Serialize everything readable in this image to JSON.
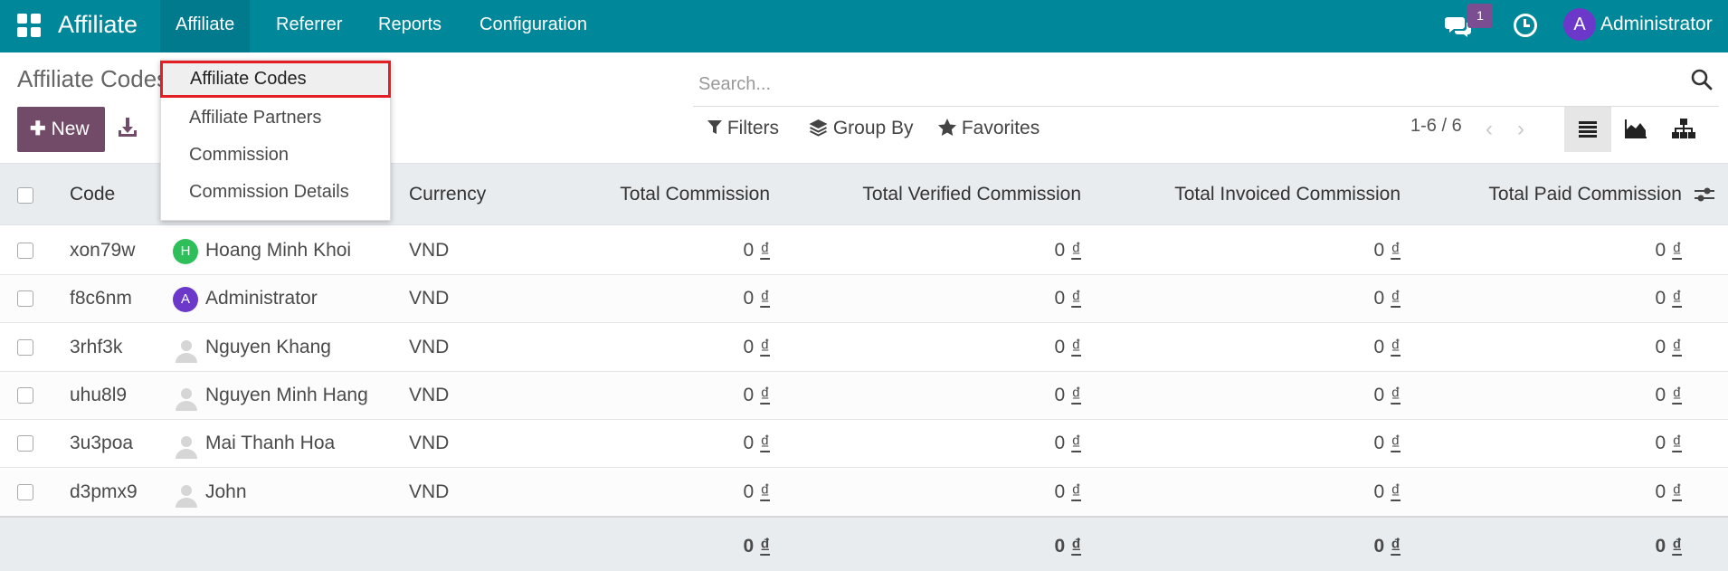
{
  "navbar": {
    "brand": "Affiliate",
    "menus": [
      "Affiliate",
      "Referrer",
      "Reports",
      "Configuration"
    ],
    "chat_count": "1",
    "user_initial": "A",
    "user_name": "Administrator",
    "bg_color": "#00879a"
  },
  "dropdown": {
    "items": [
      "Affiliate Codes",
      "Affiliate Partners",
      "Commission",
      "Commission Details"
    ],
    "selected": "Affiliate Codes"
  },
  "control_panel": {
    "breadcrumb": "Affiliate Codes",
    "new_label": "New",
    "search_placeholder": "Search...",
    "filters_label": "Filters",
    "group_by_label": "Group By",
    "favorites_label": "Favorites",
    "pager": "1-6 / 6",
    "accent_color": "#714b67"
  },
  "table": {
    "columns": {
      "code": "Code",
      "currency": "Currency",
      "total_commission": "Total Commission",
      "total_verified": "Total Verified Commission",
      "total_invoiced": "Total Invoiced Commission",
      "total_paid": "Total Paid Commission"
    },
    "rows": [
      {
        "code": "xon79w",
        "partner": "Hoang Minh Khoi",
        "avatar": "H",
        "avatar_color": "#2ebf5b",
        "currency": "VND",
        "total": "0",
        "verified": "0",
        "invoiced": "0",
        "paid": "0"
      },
      {
        "code": "f8c6nm",
        "partner": "Administrator",
        "avatar": "A",
        "avatar_color": "#6b38c9",
        "currency": "VND",
        "total": "0",
        "verified": "0",
        "invoiced": "0",
        "paid": "0"
      },
      {
        "code": "3rhf3k",
        "partner": "Nguyen Khang",
        "avatar": "",
        "avatar_color": "",
        "currency": "VND",
        "total": "0",
        "verified": "0",
        "invoiced": "0",
        "paid": "0"
      },
      {
        "code": "uhu8l9",
        "partner": "Nguyen Minh Hang",
        "avatar": "",
        "avatar_color": "",
        "currency": "VND",
        "total": "0",
        "verified": "0",
        "invoiced": "0",
        "paid": "0"
      },
      {
        "code": "3u3poa",
        "partner": "Mai Thanh Hoa",
        "avatar": "",
        "avatar_color": "",
        "currency": "VND",
        "total": "0",
        "verified": "0",
        "invoiced": "0",
        "paid": "0"
      },
      {
        "code": "d3pmx9",
        "partner": "John",
        "avatar": "",
        "avatar_color": "",
        "currency": "VND",
        "total": "0",
        "verified": "0",
        "invoiced": "0",
        "paid": "0"
      }
    ],
    "currency_symbol": "₫",
    "totals": {
      "total": "0",
      "verified": "0",
      "invoiced": "0",
      "paid": "0"
    }
  }
}
